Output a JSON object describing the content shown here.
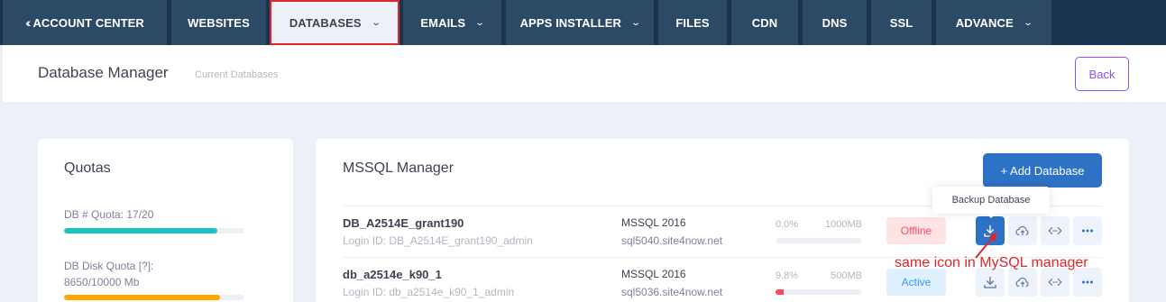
{
  "nav": {
    "tabs": [
      {
        "label": "ACCOUNT CENTER"
      },
      {
        "label": "WEBSITES"
      },
      {
        "label": "DATABASES"
      },
      {
        "label": "EMAILS"
      },
      {
        "label": "APPS INSTALLER"
      },
      {
        "label": "FILES"
      },
      {
        "label": "CDN"
      },
      {
        "label": "DNS"
      },
      {
        "label": "SSL"
      },
      {
        "label": "ADVANCE"
      }
    ]
  },
  "subheader": {
    "title": "Database Manager",
    "description": "Current Databases",
    "back_label": "Back"
  },
  "quotas": {
    "title": "Quotas",
    "db_quota_label": "DB # Quota: 17/20",
    "db_quota_fraction": 0.85,
    "disk_quota_label_line1": "DB Disk Quota [?]:",
    "disk_quota_label_line2": "8650/10000 Mb",
    "disk_quota_fraction": 0.865,
    "colors": {
      "db_quota": "#1bc5bd",
      "disk_quota": "#ffa800"
    }
  },
  "mssql": {
    "title": "MSSQL Manager",
    "add_label": "+ Add Database",
    "rows": [
      {
        "name": "DB_A2514E_grant190",
        "login": "Login ID: DB_A2514E_grant190_admin",
        "version": "MSSQL 2016",
        "server": "sql5040.site4now.net",
        "usage_pct": "0.0%",
        "size": "1000MB",
        "usage_fraction": 0.0,
        "status": "Offline"
      },
      {
        "name": "db_a2514e_k90_1",
        "login": "Login ID: db_a2514e_k90_1_admin",
        "version": "MSSQL 2016",
        "server": "sql5036.site4now.net",
        "usage_pct": "9.8%",
        "size": "500MB",
        "usage_fraction": 0.098,
        "status": "Active"
      }
    ],
    "actions": [
      "download-icon",
      "cloud-upload-icon",
      "code-link-icon",
      "more-icon"
    ]
  },
  "tooltip": "Backup Database",
  "annotation": "same icon in MySQL manager"
}
